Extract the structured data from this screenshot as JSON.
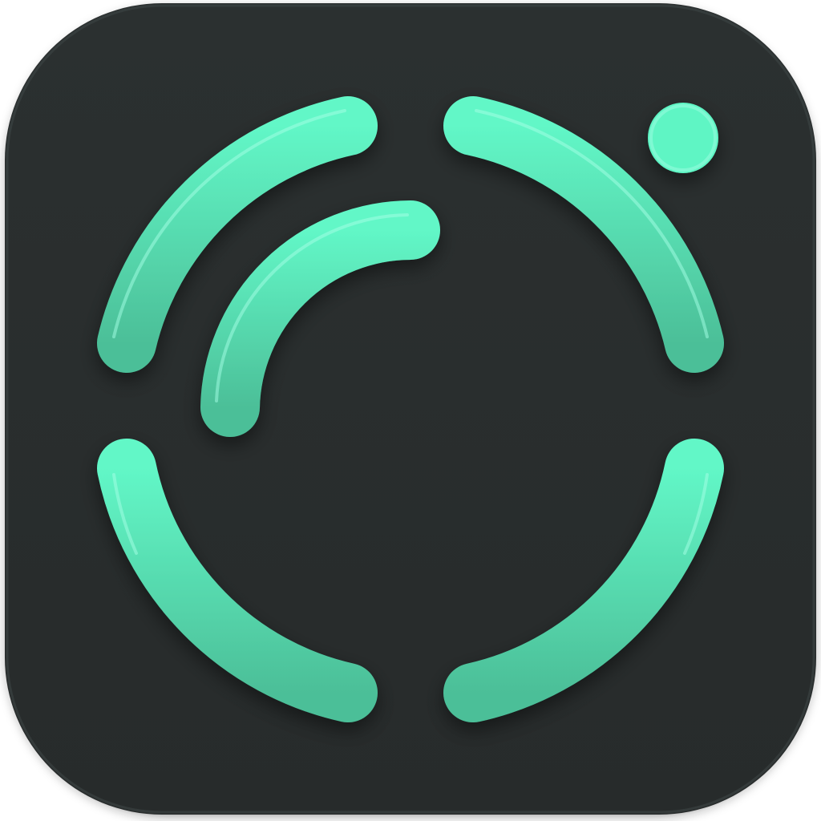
{
  "app_icon": {
    "icon_name": "dashed-ring-app-icon",
    "colors": {
      "tile": "#2b3030",
      "tile_edge": "#3a3f3f",
      "accent_top": "#62f7c7",
      "accent_bottom": "#4cbf98",
      "highlight": "#9bffe3"
    },
    "elements": [
      "outer-ring-arc-top-left",
      "outer-ring-arc-top-right",
      "outer-ring-arc-bottom-left",
      "outer-ring-arc-bottom-right",
      "inner-arc",
      "notification-dot"
    ]
  }
}
